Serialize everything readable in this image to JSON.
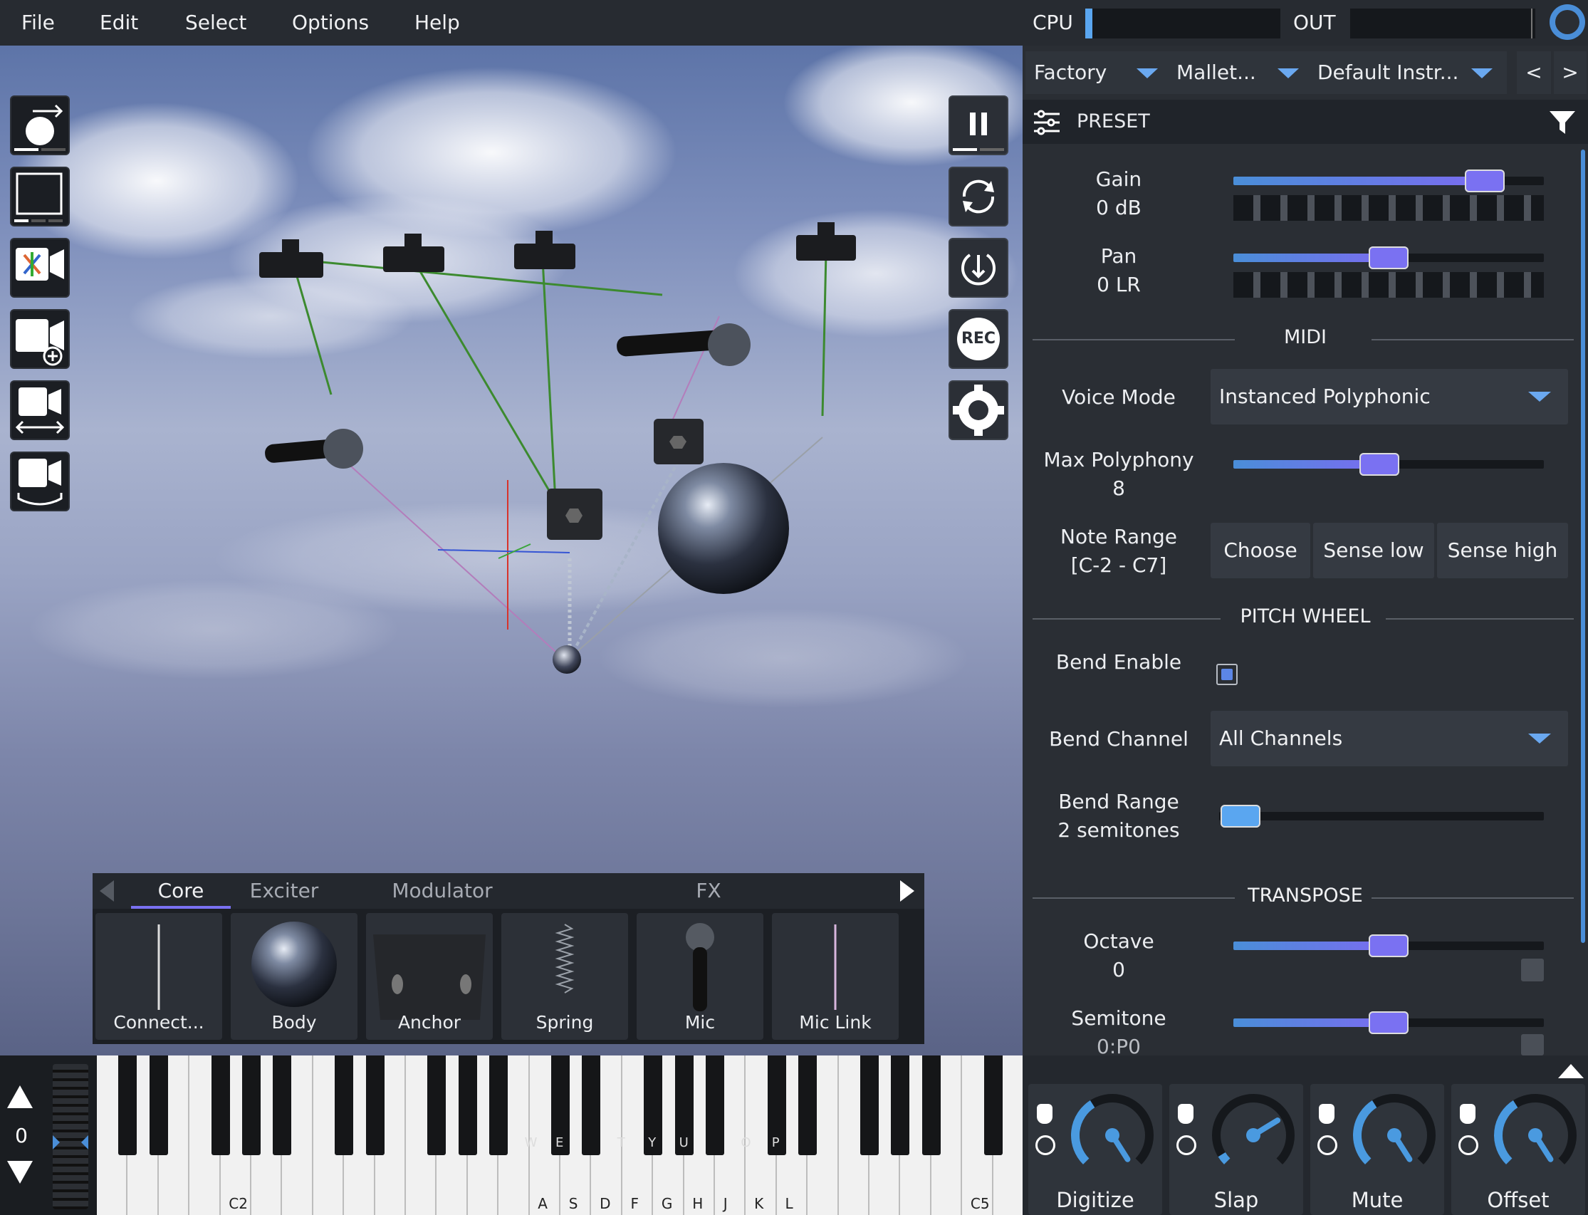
{
  "menu": {
    "file": "File",
    "edit": "Edit",
    "select": "Select",
    "options": "Options",
    "help": "Help"
  },
  "meters": {
    "cpu_label": "CPU",
    "out_label": "OUT",
    "cpu_level": 0.03,
    "out_level": 0.0
  },
  "preset_bar": {
    "bank": "Factory",
    "category": "Mallet...",
    "preset": "Default Instr...",
    "prev": "<",
    "next": ">"
  },
  "preset_header": {
    "title": "PRESET"
  },
  "params": {
    "gain": {
      "label": "Gain",
      "value": "0 dB",
      "level": 0.81
    },
    "pan": {
      "label": "Pan",
      "value": "0 LR",
      "level": 0.5
    },
    "midi_title": "MIDI",
    "voice_mode": {
      "label": "Voice Mode",
      "value": "Instanced Polyphonic"
    },
    "max_polyphony": {
      "label": "Max Polyphony",
      "value": "8",
      "level": 0.47
    },
    "note_range": {
      "label": "Note Range",
      "value": "[C-2 - C7]",
      "choose": "Choose",
      "sense_low": "Sense low",
      "sense_high": "Sense high"
    },
    "pitch_wheel_title": "PITCH WHEEL",
    "bend_enable": {
      "label": "Bend Enable",
      "checked": true
    },
    "bend_channel": {
      "label": "Bend Channel",
      "value": "All Channels"
    },
    "bend_range": {
      "label": "Bend Range",
      "value": "2 semitones",
      "level": 0.01
    },
    "transpose_title": "TRANSPOSE",
    "octave": {
      "label": "Octave",
      "value": "0",
      "level": 0.5
    },
    "semitone": {
      "label": "Semitone",
      "value": "0:P0",
      "level": 0.5
    }
  },
  "palette": {
    "tabs": [
      "Core",
      "Exciter",
      "Modulator",
      "FX"
    ],
    "active_tab": "Core",
    "items": [
      "Connect...",
      "Body",
      "Anchor",
      "Spring",
      "Mic",
      "Mic Link"
    ]
  },
  "transport": {
    "rec": "REC"
  },
  "keyboard": {
    "octave_value": "0",
    "white_labels": [
      {
        "key": 4,
        "text": "C2"
      },
      {
        "key": 14,
        "text": "A"
      },
      {
        "key": 15,
        "text": "S"
      },
      {
        "key": 16,
        "text": "D"
      },
      {
        "key": 17,
        "text": "F"
      },
      {
        "key": 18,
        "text": "G"
      },
      {
        "key": 19,
        "text": "H"
      },
      {
        "key": 20,
        "text": "J"
      },
      {
        "key": 21,
        "text": "K"
      },
      {
        "key": 22,
        "text": "L"
      },
      {
        "key": 28,
        "text": "C5"
      }
    ],
    "black_labels": [
      "W",
      "E",
      "T",
      "Y",
      "U",
      "O",
      "P"
    ]
  },
  "macros": [
    {
      "label": "Digitize",
      "value": 0.38
    },
    {
      "label": "Slap",
      "value": 0.05
    },
    {
      "label": "Mute",
      "value": 0.38
    },
    {
      "label": "Offset",
      "value": 0.38
    }
  ],
  "colors": {
    "accent": "#7a71f2",
    "slider_start": "#4a8ed8",
    "knob": "#4a9ae0"
  }
}
